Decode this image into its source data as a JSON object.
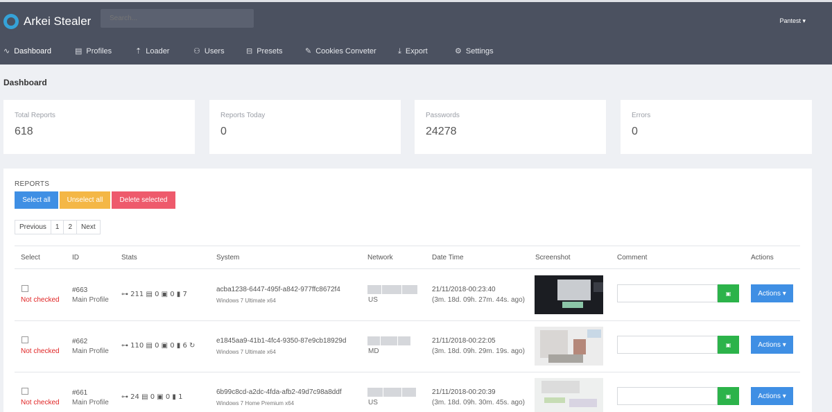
{
  "app": {
    "name": "Arkei Stealer",
    "search_placeholder": "Search...",
    "user": "Pantest ▾"
  },
  "nav": [
    {
      "label": "Dashboard",
      "icon": "activity-icon"
    },
    {
      "label": "Profiles",
      "icon": "profiles-icon"
    },
    {
      "label": "Loader",
      "icon": "upload-icon"
    },
    {
      "label": "Users",
      "icon": "users-icon"
    },
    {
      "label": "Presets",
      "icon": "drive-icon"
    },
    {
      "label": "Cookies Conveter",
      "icon": "edit-icon"
    },
    {
      "label": "Export",
      "icon": "download-icon"
    },
    {
      "label": "Settings",
      "icon": "gear-icon"
    }
  ],
  "page_title": "Dashboard",
  "stats": [
    {
      "label": "Total Reports",
      "value": "618"
    },
    {
      "label": "Reports Today",
      "value": "0"
    },
    {
      "label": "Passwords",
      "value": "24278"
    },
    {
      "label": "Errors",
      "value": "0"
    }
  ],
  "reports": {
    "title": "REPORTS",
    "buttons": {
      "select_all": "Select all",
      "unselect_all": "Unselect all",
      "delete_selected": "Delete selected"
    },
    "pager": {
      "prev": "Previous",
      "p1": "1",
      "p2": "2",
      "next": "Next"
    },
    "columns": {
      "select": "Select",
      "id": "ID",
      "stats": "Stats",
      "system": "System",
      "network": "Network",
      "datetime": "Date Time",
      "screenshot": "Screenshot",
      "comment": "Comment",
      "actions": "Actions"
    },
    "rows": [
      {
        "status": "Not checked",
        "id": "#663",
        "profile": "Main Profile",
        "stats": "⊶ 211 ▤ 0 ▣ 0 ▮ 7",
        "hash": "acba1238-6447-495f-a842-977ffc8672f4",
        "os": "Windows 7 Ultimate x64",
        "country": "US",
        "date": "21/11/2018-00:23:40",
        "ago": "(3m. 18d. 09h. 27m. 44s. ago)",
        "actions": "Actions ▾"
      },
      {
        "status": "Not checked",
        "id": "#662",
        "profile": "Main Profile",
        "stats": "⊶ 110 ▤ 0 ▣ 0 ▮ 6 ↻",
        "hash": "e1845aa9-41b1-4fc4-9350-87e9cb18929d",
        "os": "Windows 7 Ultimate x64",
        "country": "MD",
        "date": "21/11/2018-00:22:05",
        "ago": "(3m. 18d. 09h. 29m. 19s. ago)",
        "actions": "Actions ▾"
      },
      {
        "status": "Not checked",
        "id": "#661",
        "profile": "Main Profile",
        "stats": "⊶ 24 ▤ 0 ▣ 0 ▮ 1",
        "hash": "6b99c8cd-a2dc-4fda-afb2-49d7c98a8ddf",
        "os": "Windows 7 Home Premium x64",
        "country": "US",
        "date": "21/11/2018-00:20:39",
        "ago": "(3m. 18d. 09h. 30m. 45s. ago)",
        "actions": "Actions ▾"
      }
    ]
  }
}
